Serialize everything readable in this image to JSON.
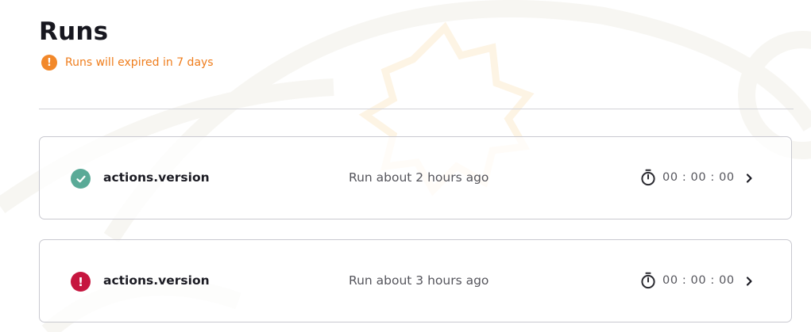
{
  "page": {
    "title": "Runs",
    "notice": {
      "icon": "exclamation-circle-icon",
      "icon_glyph": "!",
      "text": "Runs will expired in 7 days",
      "color": "#ef7d1c"
    }
  },
  "runs": [
    {
      "status": "success",
      "status_icon": "check-circle-icon",
      "name": "actions.version",
      "time": "Run about 2 hours ago",
      "duration": "00 : 00 : 00",
      "timer_icon": "stopwatch-icon",
      "chevron_icon": "chevron-right-icon"
    },
    {
      "status": "error",
      "status_icon": "exclamation-circle-icon",
      "status_glyph": "!",
      "name": "actions.version",
      "time": "Run about 3 hours ago",
      "duration": "00 : 00 : 00",
      "timer_icon": "stopwatch-icon",
      "chevron_icon": "chevron-right-icon"
    }
  ],
  "colors": {
    "success": "#5aaa97",
    "error": "#c6163f",
    "warning": "#f2882a"
  }
}
